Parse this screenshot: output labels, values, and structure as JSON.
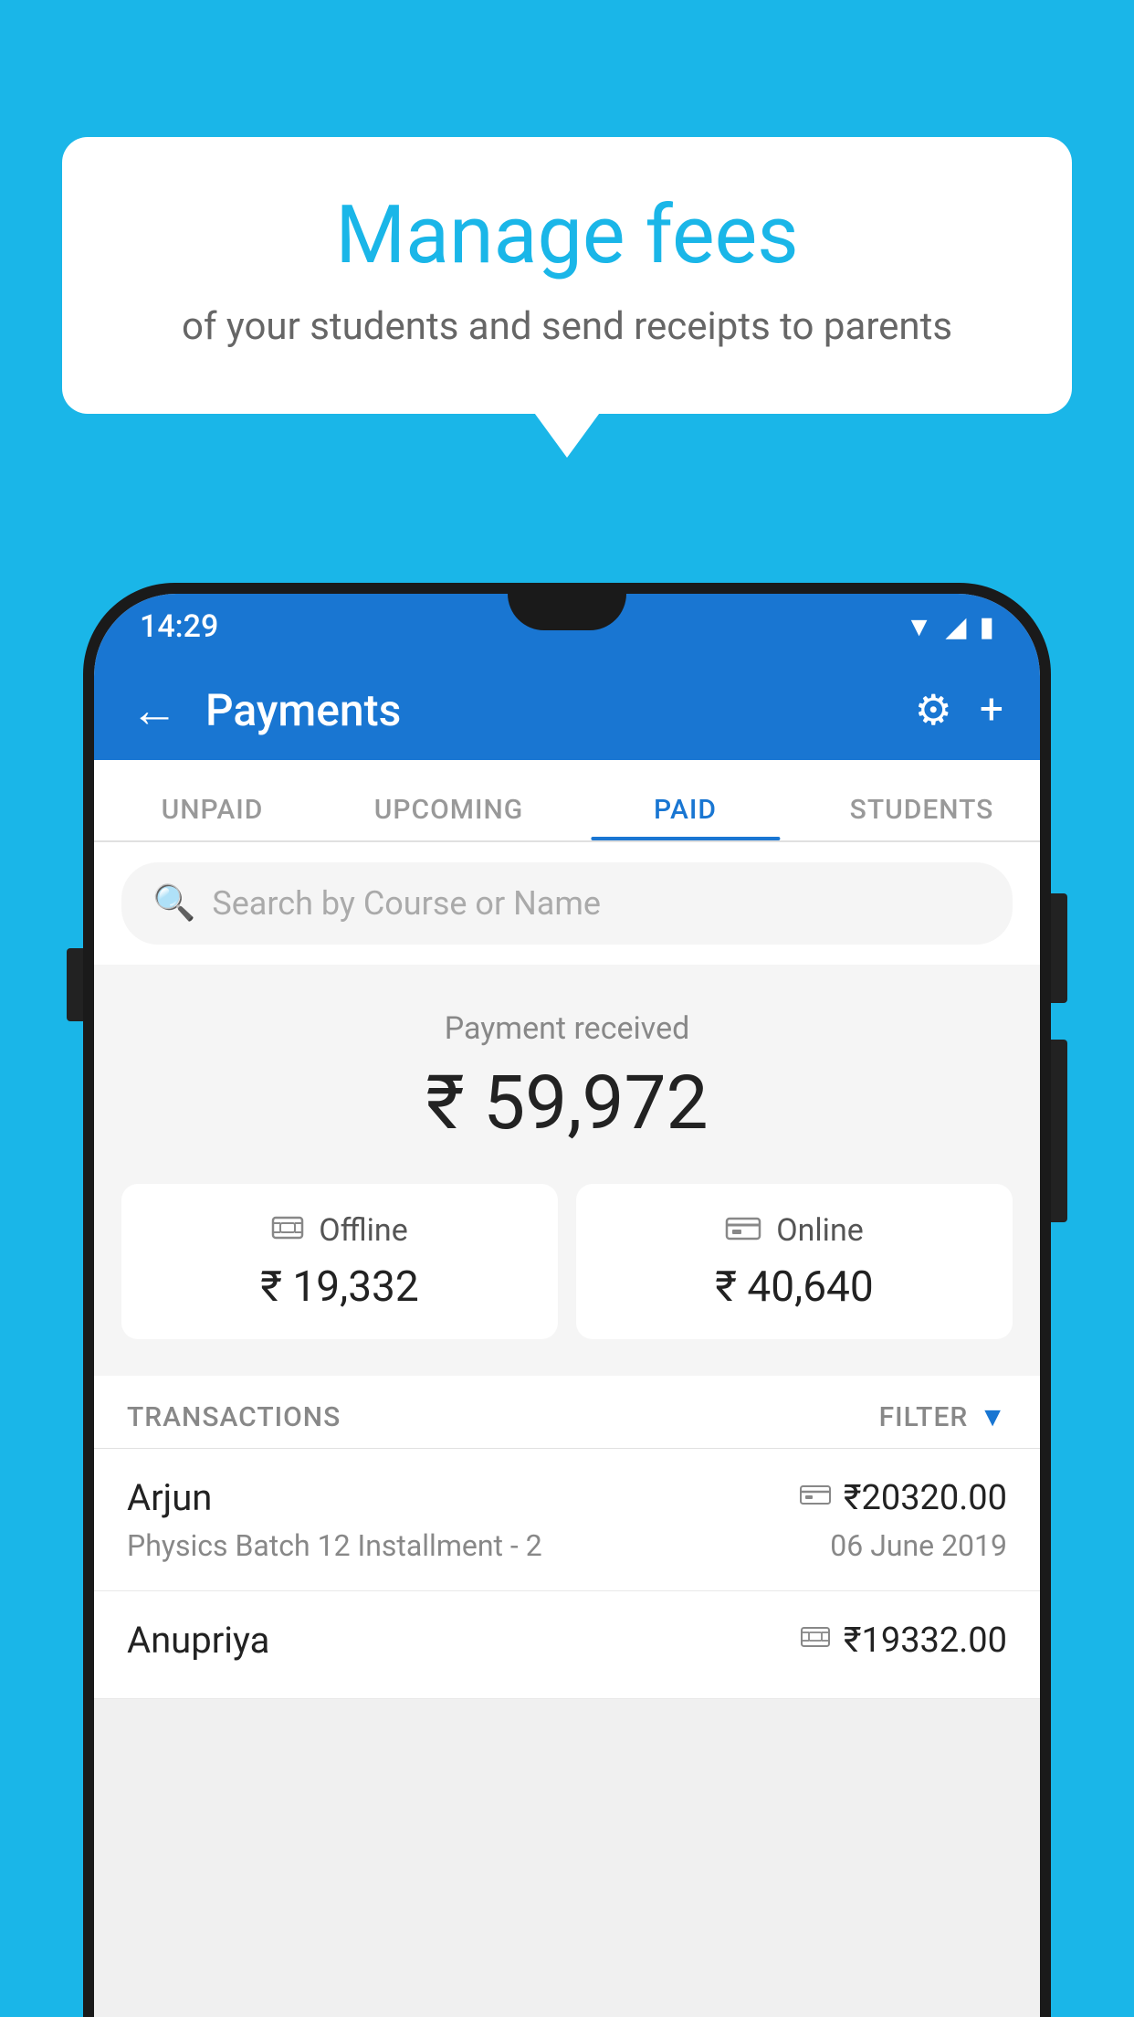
{
  "background_color": "#1ab6e8",
  "bubble": {
    "title": "Manage fees",
    "subtitle": "of your students and send receipts to parents"
  },
  "status_bar": {
    "time": "14:29",
    "wifi": "▼",
    "signal": "▲",
    "battery": "▮"
  },
  "app_bar": {
    "title": "Payments",
    "back_label": "←",
    "gear_label": "⚙",
    "plus_label": "+"
  },
  "tabs": [
    {
      "label": "UNPAID",
      "active": false
    },
    {
      "label": "UPCOMING",
      "active": false
    },
    {
      "label": "PAID",
      "active": true
    },
    {
      "label": "STUDENTS",
      "active": false
    }
  ],
  "search": {
    "placeholder": "Search by Course or Name"
  },
  "payment_received": {
    "label": "Payment received",
    "amount": "₹ 59,972",
    "offline": {
      "type": "Offline",
      "amount": "₹ 19,332"
    },
    "online": {
      "type": "Online",
      "amount": "₹ 40,640"
    }
  },
  "transactions": {
    "label": "TRANSACTIONS",
    "filter_label": "FILTER",
    "items": [
      {
        "name": "Arjun",
        "amount": "₹20320.00",
        "course": "Physics Batch 12 Installment - 2",
        "date": "06 June 2019",
        "type": "online"
      },
      {
        "name": "Anupriya",
        "amount": "₹19332.00",
        "course": "",
        "date": "",
        "type": "offline"
      }
    ]
  }
}
